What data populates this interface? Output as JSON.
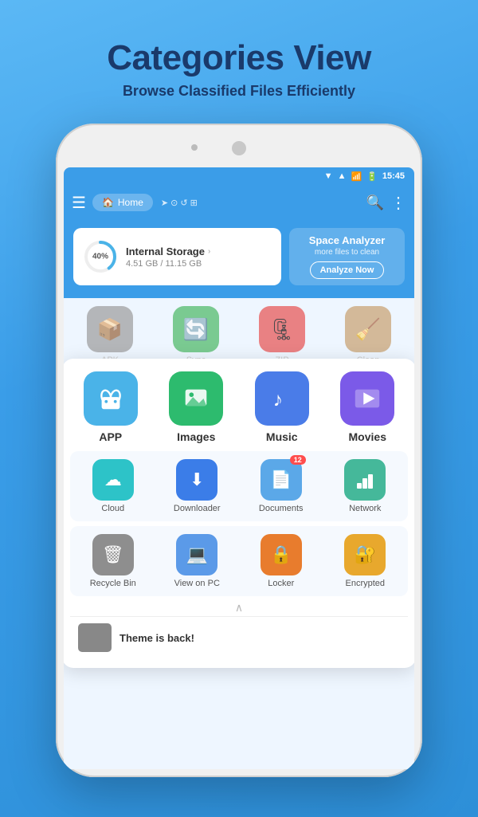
{
  "header": {
    "title": "Categories View",
    "subtitle": "Browse Classified Files Efficiently"
  },
  "statusbar": {
    "time": "15:45"
  },
  "toolbar": {
    "home_label": "Home",
    "search_label": "Search",
    "more_label": "More"
  },
  "storage": {
    "title": "Internal Storage",
    "used": "4.51 GB / 11.15 GB",
    "percent": 40,
    "analyze_title": "Space Analyzer",
    "analyze_sub": "more files to clean",
    "analyze_btn": "Analyze Now"
  },
  "featured_categories": [
    {
      "id": "app",
      "label": "APP",
      "color": "#4ab3e8",
      "icon": "🤖"
    },
    {
      "id": "images",
      "label": "Images",
      "color": "#2dbb6e",
      "icon": "🖼"
    },
    {
      "id": "music",
      "label": "Music",
      "color": "#4a7ce8",
      "icon": "🎵"
    },
    {
      "id": "movies",
      "label": "Movies",
      "color": "#7b4ae8",
      "icon": "🎬"
    }
  ],
  "small_categories": [
    {
      "id": "cloud",
      "label": "Cloud",
      "color": "#2dc3c8",
      "icon": "☁",
      "badge": null
    },
    {
      "id": "downloader",
      "label": "Downloader",
      "color": "#3b7de8",
      "icon": "⬇",
      "badge": null
    },
    {
      "id": "documents",
      "label": "Documents",
      "color": "#5ba8e8",
      "icon": "📄",
      "badge": "12"
    },
    {
      "id": "network",
      "label": "Network",
      "color": "#45b89a",
      "icon": "📡",
      "badge": null
    },
    {
      "id": "recycle",
      "label": "Recycle Bin",
      "color": "#8e8e8e",
      "icon": "🗑",
      "badge": null
    },
    {
      "id": "view-pc",
      "label": "View on PC",
      "color": "#5b9ae8",
      "icon": "💻",
      "badge": null
    },
    {
      "id": "locker",
      "label": "Locker",
      "color": "#e87c2d",
      "icon": "🔒",
      "badge": null
    },
    {
      "id": "encrypted",
      "label": "Encrypted",
      "color": "#e8a82d",
      "icon": "🔐",
      "badge": null
    }
  ],
  "bg_categories": [
    {
      "label": "APK",
      "color": "#9c9c9c",
      "icon": "📦"
    },
    {
      "label": "Sync",
      "color": "#4ab863",
      "icon": "🔄"
    },
    {
      "label": "ZIP",
      "color": "#e85050",
      "icon": "🗜"
    },
    {
      "label": "Clean",
      "color": "#c8a06e",
      "icon": "🧹"
    }
  ],
  "bottom": {
    "text": "Theme is back!"
  }
}
